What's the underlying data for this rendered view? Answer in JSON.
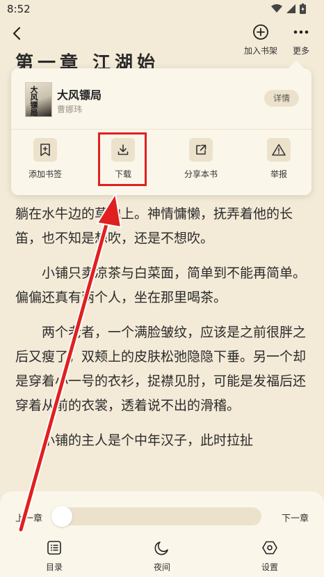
{
  "status": {
    "time": "8:52"
  },
  "top_bar": {
    "add_to_shelf": "加入书架",
    "more": "更多"
  },
  "chapter": {
    "title": "第一章 江湖始"
  },
  "popup": {
    "book_title": "大风镖局",
    "author": "曹娜玮",
    "cover_text": "大风镖局",
    "detail_label": "详情",
    "actions": [
      {
        "label": "添加书签",
        "icon": "bookmark-add-icon"
      },
      {
        "label": "下载",
        "icon": "download-icon"
      },
      {
        "label": "分享本书",
        "icon": "share-icon"
      },
      {
        "label": "举报",
        "icon": "warning-icon"
      }
    ]
  },
  "reading": {
    "paragraphs": [
      "躺在水牛边的草地上。神情慵懒，抚弄着他的长笛，也不知是想吹，还是不想吹。",
      "小铺只卖凉茶与白菜面，简单到不能再简单。偏偏还真有两个人，坐在那里喝茶。",
      "两个老者，一个满脸皱纹，应该是之前很胖之后又瘦了，双颊上的皮肤松弛隐隐下垂。另一个却是穿着小一号的衣衫，捉襟见肘，可能是发福后还穿着从前的衣裳，透着说不出的滑稽。",
      "小铺的主人是个中年汉子，此时拉扯"
    ]
  },
  "bottom": {
    "prev_chapter": "上一章",
    "next_chapter": "下一章",
    "progress": 0.0,
    "tabs": [
      {
        "label": "目录",
        "icon": "toc-icon"
      },
      {
        "label": "夜间",
        "icon": "moon-icon"
      },
      {
        "label": "设置",
        "icon": "settings-icon"
      }
    ]
  },
  "colors": {
    "highlight": "#e02020",
    "background": "#f3ead7",
    "panel": "#fbf6ea"
  }
}
